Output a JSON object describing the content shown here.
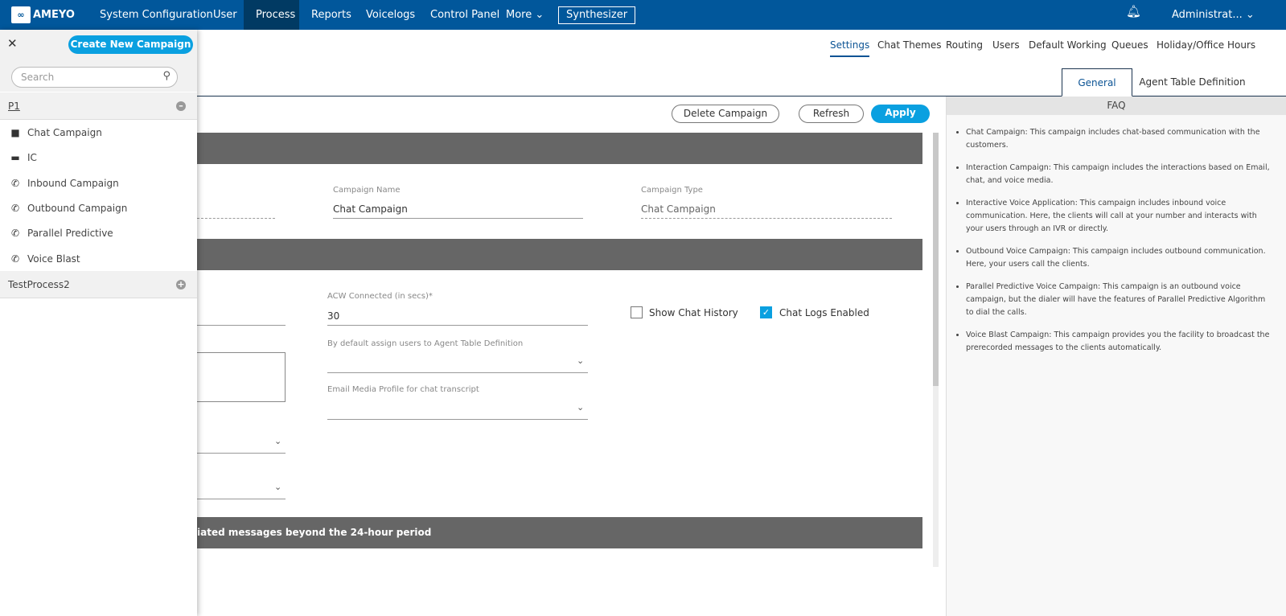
{
  "topnav": {
    "logo": "AMEYO",
    "items": [
      "System Configuration",
      "User",
      "Process",
      "Reports",
      "Voicelogs",
      "Control Panel",
      "More"
    ],
    "active": "Process",
    "synthesizer": "Synthesizer",
    "user": "Administrat...",
    "accent": "#01579b"
  },
  "subnav": {
    "items": [
      "Settings",
      "Chat Themes",
      "Routing",
      "Users",
      "Default Working",
      "Queues",
      "Holiday/Office Hours"
    ],
    "active": "Settings"
  },
  "tabs": {
    "items": [
      "General",
      "Agent Table Definition"
    ],
    "active": "General"
  },
  "toolbar": {
    "delete": "Delete Campaign",
    "refresh": "Refresh",
    "apply": "Apply"
  },
  "form": {
    "campaign_name_label": "Campaign Name",
    "campaign_name": "Chat Campaign",
    "campaign_type_label": "Campaign Type",
    "campaign_type": "Chat Campaign",
    "acw_label": "ACW Connected (in secs)*",
    "acw": "30",
    "show_chat_history": "Show Chat History",
    "show_chat_history_checked": false,
    "chat_logs": "Chat Logs Enabled",
    "chat_logs_checked": true,
    "atd_label": "By default assign users to Agent Table Definition",
    "email_label": "Email Media Profile for chat transcript",
    "bar3_text": "iated messages beyond the 24-hour period"
  },
  "sidebar": {
    "create": "Create New Campaign",
    "search_placeholder": "Search",
    "groups": [
      {
        "name": "P1",
        "expanded": true,
        "items": [
          {
            "label": "Chat Campaign",
            "icon": "chat-icon"
          },
          {
            "label": "IC",
            "icon": "ticket-icon"
          },
          {
            "label": "Inbound Campaign",
            "icon": "inbound-call-icon"
          },
          {
            "label": "Outbound Campaign",
            "icon": "outbound-call-icon"
          },
          {
            "label": "Parallel Predictive",
            "icon": "parallel-call-icon"
          },
          {
            "label": "Voice Blast",
            "icon": "voice-blast-icon"
          }
        ]
      },
      {
        "name": "TestProcess2",
        "expanded": false
      }
    ]
  },
  "faq": {
    "title": "FAQ",
    "items": [
      "Chat Campaign: This campaign includes chat-based communication with the customers.",
      "Interaction Campaign: This campaign includes the interactions based on Email, chat, and voice media.",
      "Interactive Voice Application: This campaign includes inbound voice communication. Here, the clients will call at your number and interacts with your users through an IVR or directly.",
      "Outbound Voice Campaign: This campaign includes outbound communication. Here, your users call the clients.",
      "Parallel Predictive Voice Campaign: This campaign is an outbound voice campaign, but the dialer will have the features of Parallel Predictive Algorithm to dial the calls.",
      "Voice Blast Campaign: This campaign provides you the facility to broadcast the prerecorded messages to the clients automatically."
    ]
  }
}
